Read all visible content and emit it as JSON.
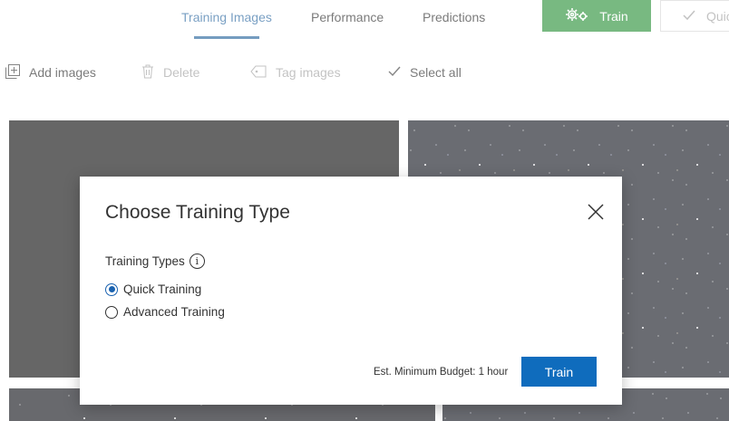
{
  "nav": {
    "tabs": [
      {
        "label": "Training Images",
        "active": true
      },
      {
        "label": "Performance",
        "active": false
      },
      {
        "label": "Predictions",
        "active": false
      }
    ],
    "train_button": {
      "label": "Train",
      "icon": "gears-icon",
      "color": "#1e8a2e"
    },
    "quick_test_button": {
      "label": "Quick Test",
      "icon": "check-icon"
    }
  },
  "toolbar": {
    "add_images": {
      "label": "Add images",
      "icon": "add-image-icon"
    },
    "delete": {
      "label": "Delete",
      "icon": "trash-icon",
      "disabled": true
    },
    "tag_images": {
      "label": "Tag images",
      "icon": "tag-icon",
      "disabled": true
    },
    "select_all": {
      "label": "Select all",
      "icon": "check-icon"
    }
  },
  "dialog": {
    "title": "Choose Training Type",
    "field_label": "Training Types",
    "info_glyph": "i",
    "options": [
      {
        "label": "Quick Training",
        "selected": true
      },
      {
        "label": "Advanced Training",
        "selected": false
      }
    ],
    "budget_text": "Est. Minimum Budget: 1 hour",
    "train_label": "Train",
    "accent_color": "#0f6cbd"
  }
}
